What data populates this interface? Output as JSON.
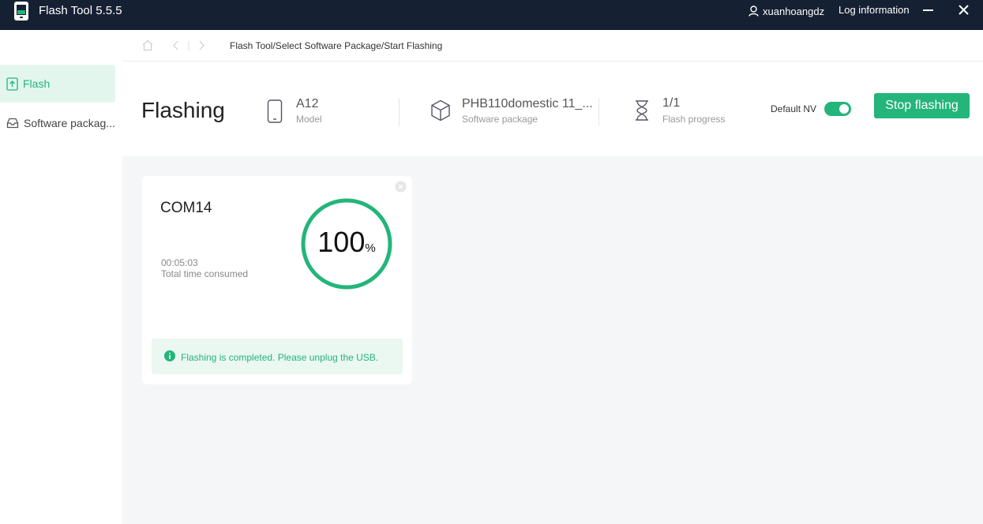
{
  "app": {
    "title": "Flash Tool 5.5.5",
    "username": "xuanhoangdz",
    "log_info_label": "Log information"
  },
  "sidebar": {
    "items": [
      {
        "label": "Flash",
        "icon": "upload-file-icon",
        "active": true
      },
      {
        "label": "Software packag...",
        "icon": "package-tray-icon",
        "active": false
      }
    ]
  },
  "breadcrumb": {
    "text": "Flash Tool/Select Software Package/Start Flashing"
  },
  "header": {
    "title": "Flashing",
    "model": {
      "value": "A12",
      "label": "Model",
      "icon": "phone-icon"
    },
    "package": {
      "value": "PHB110domestic 11_...",
      "label": "Software package",
      "icon": "cube-icon"
    },
    "progress": {
      "value": "1/1",
      "label": "Flash progress",
      "icon": "hourglass-icon"
    },
    "default_nv": {
      "label": "Default NV",
      "enabled": true
    },
    "stop_button": "Stop flashing"
  },
  "device_card": {
    "port": "COM14",
    "elapsed": "00:05:03",
    "elapsed_label": "Total time consumed",
    "percent": "100",
    "percent_sign": "%",
    "progress_fraction": 1.0,
    "status_message": "Flashing is completed. Please unplug the USB."
  },
  "colors": {
    "accent": "#23b57a",
    "titlebar": "#162033",
    "content_bg": "#f5f6f8",
    "active_bg": "#e3f6ee"
  }
}
